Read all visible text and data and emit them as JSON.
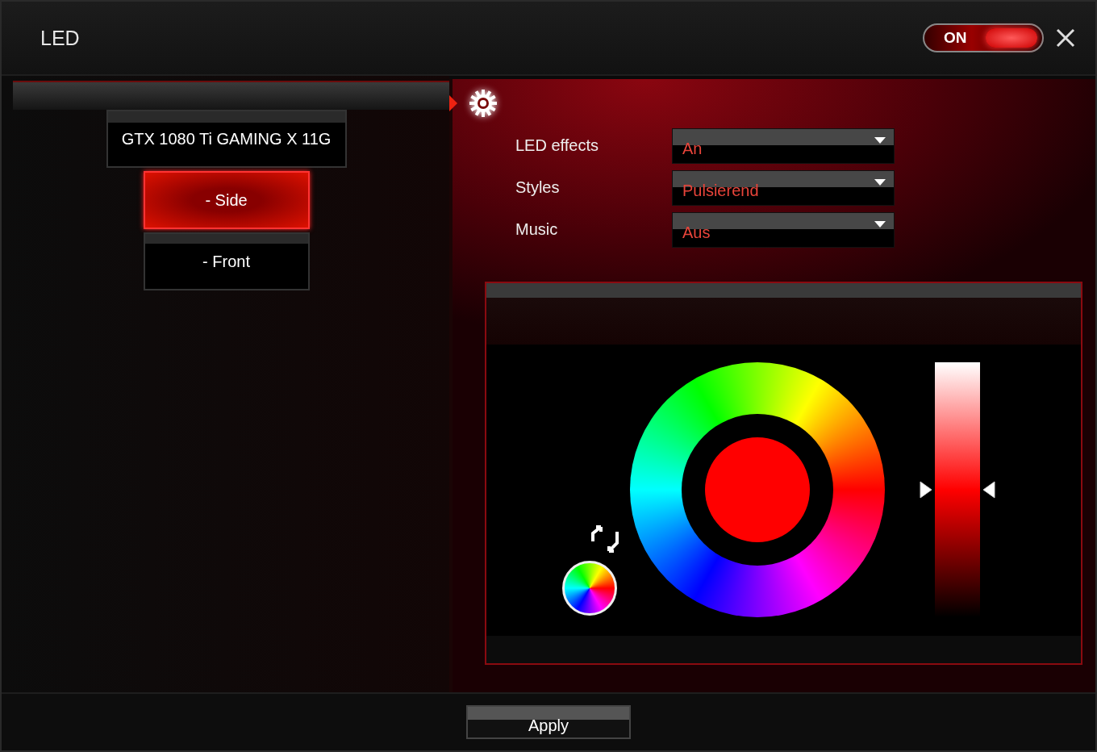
{
  "window": {
    "title": "LED"
  },
  "power_toggle": {
    "label": "ON",
    "on": true
  },
  "devices": [
    {
      "label": "GTX 1080 Ti GAMING X 11G",
      "children": [
        {
          "label": "- Side",
          "selected": true
        },
        {
          "label": "- Front",
          "selected": false
        }
      ]
    }
  ],
  "settings": [
    {
      "label": "LED effects",
      "value": "An"
    },
    {
      "label": "Styles",
      "value": "Pulsierend"
    },
    {
      "label": "Music",
      "value": "Aus"
    }
  ],
  "color_picker": {
    "level": 0.5
  },
  "apply_button": "Apply"
}
